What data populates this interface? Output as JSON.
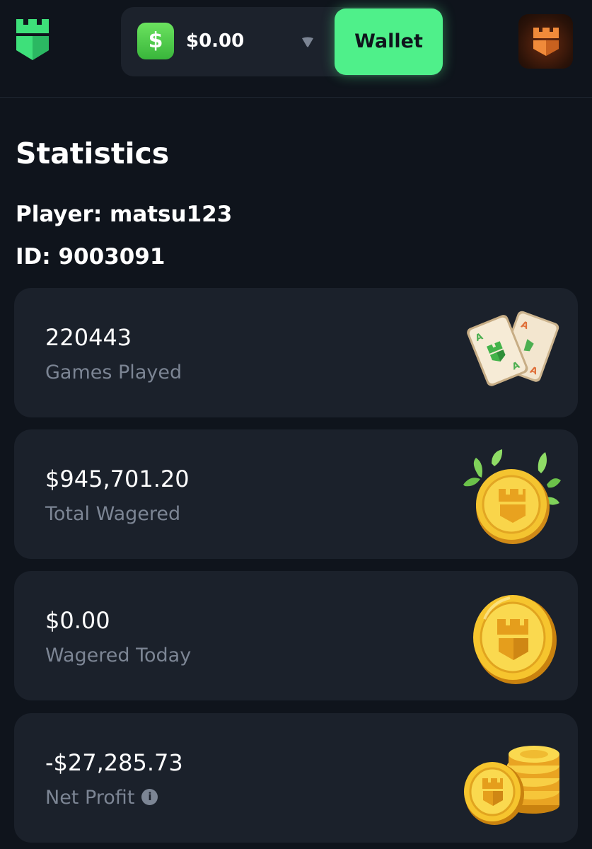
{
  "header": {
    "cash_icon_symbol": "$",
    "balance": "$0.00",
    "wallet_label": "Wallet",
    "logo_icon": "castle-logo-icon",
    "caret_icon": "chevron-down-icon",
    "avatar_icon": "castle-avatar-icon"
  },
  "page": {
    "title": "Statistics",
    "player": "Player: matsu123",
    "id": "ID: 9003091"
  },
  "stats": [
    {
      "value": "220443",
      "label": "Games Played",
      "art_icon": "playing-cards-icon"
    },
    {
      "value": "$945,701.20",
      "label": "Total Wagered",
      "art_icon": "coin-with-leaves-icon"
    },
    {
      "value": "$0.00",
      "label": "Wagered Today",
      "art_icon": "gold-coin-icon"
    },
    {
      "value": "-$27,285.73",
      "label": "Net Profit",
      "art_icon": "coin-stack-icon",
      "info_symbol": "i"
    }
  ],
  "colors": {
    "background": "#0f141c",
    "card": "#1b212b",
    "accent_green": "#4ff08a",
    "muted_text": "#7c8594"
  }
}
